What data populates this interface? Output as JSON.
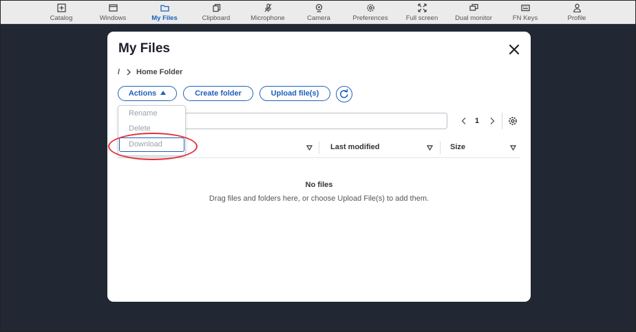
{
  "toolbar": {
    "items": [
      {
        "label": "Catalog",
        "icon": "plus-square-icon"
      },
      {
        "label": "Windows",
        "icon": "window-icon"
      },
      {
        "label": "My Files",
        "icon": "folder-icon",
        "active": true
      },
      {
        "label": "Clipboard",
        "icon": "clipboard-icon"
      },
      {
        "label": "Microphone",
        "icon": "microphone-icon"
      },
      {
        "label": "Camera",
        "icon": "camera-icon"
      },
      {
        "label": "Preferences",
        "icon": "gear-icon"
      },
      {
        "label": "Full screen",
        "icon": "fullscreen-icon"
      },
      {
        "label": "Dual monitor",
        "icon": "dual-monitor-icon"
      },
      {
        "label": "FN Keys",
        "icon": "keyboard-icon"
      },
      {
        "label": "Profile",
        "icon": "user-icon"
      }
    ]
  },
  "modal": {
    "title": "My Files",
    "breadcrumb": {
      "root": "/",
      "current": "Home Folder"
    },
    "buttons": {
      "actions": "Actions",
      "create_folder": "Create folder",
      "upload": "Upload file(s)"
    },
    "actions_menu": [
      "Rename",
      "Delete",
      "Download"
    ],
    "search": {
      "placeholder": "",
      "value": ""
    },
    "pagination": {
      "current_page": "1"
    },
    "columns": [
      "",
      "Last modified",
      "Size"
    ],
    "empty": {
      "title": "No files",
      "message": "Drag files and folders here, or choose Upload File(s) to add them."
    }
  },
  "colors": {
    "accent": "#1d5fb8",
    "backdrop": "#212834",
    "highlight": "#e3303a"
  }
}
